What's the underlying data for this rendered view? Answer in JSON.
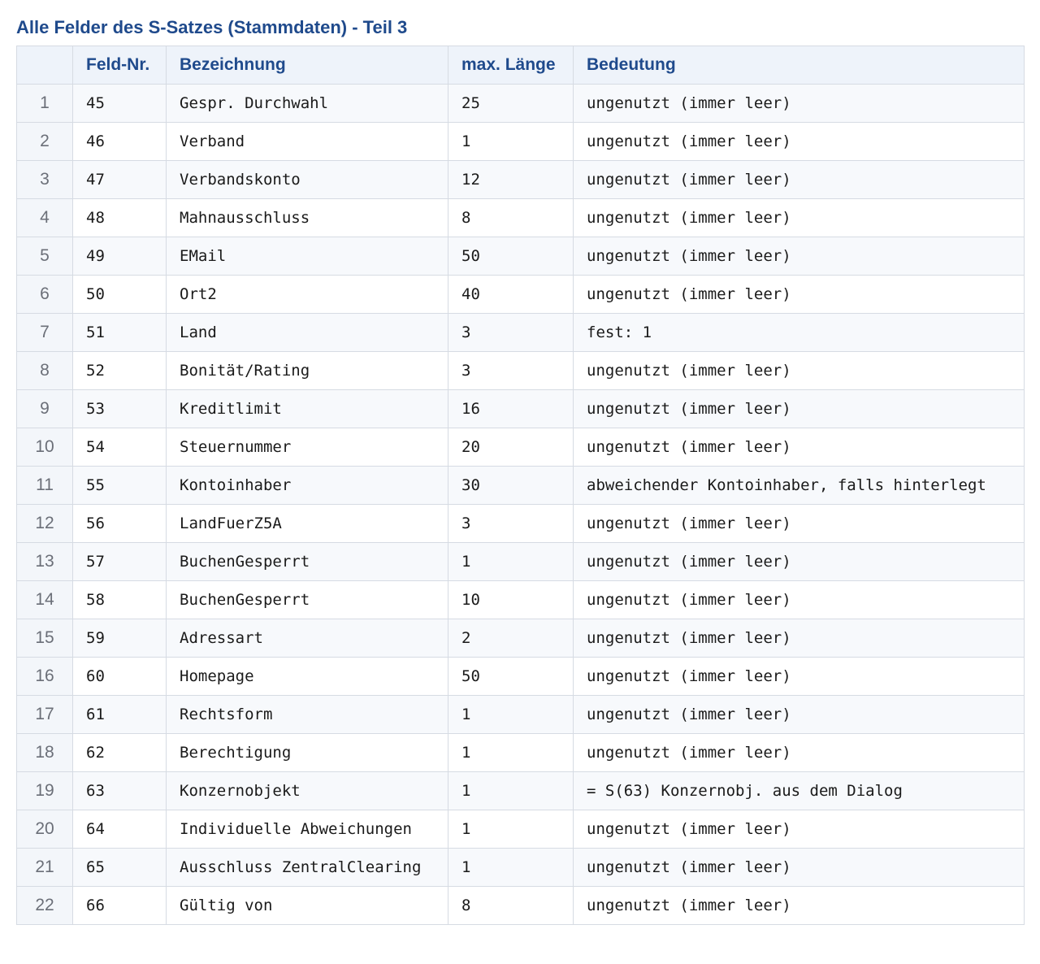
{
  "title": "Alle Felder des S-Satzes (Stammdaten) - Teil 3",
  "table": {
    "columns": [
      "",
      "Feld-Nr.",
      "Bezeichnung",
      "max. Länge",
      "Bedeutung"
    ],
    "rows": [
      {
        "index": "1",
        "feld_nr": "45",
        "bezeichnung": "Gespr. Durchwahl",
        "max_laenge": "25",
        "bedeutung": "ungenutzt (immer leer)"
      },
      {
        "index": "2",
        "feld_nr": "46",
        "bezeichnung": "Verband",
        "max_laenge": "1",
        "bedeutung": "ungenutzt (immer leer)"
      },
      {
        "index": "3",
        "feld_nr": "47",
        "bezeichnung": "Verbandskonto",
        "max_laenge": "12",
        "bedeutung": "ungenutzt (immer leer)"
      },
      {
        "index": "4",
        "feld_nr": "48",
        "bezeichnung": "Mahnausschluss",
        "max_laenge": "8",
        "bedeutung": "ungenutzt (immer leer)"
      },
      {
        "index": "5",
        "feld_nr": "49",
        "bezeichnung": "EMail",
        "max_laenge": "50",
        "bedeutung": "ungenutzt (immer leer)"
      },
      {
        "index": "6",
        "feld_nr": "50",
        "bezeichnung": "Ort2",
        "max_laenge": "40",
        "bedeutung": "ungenutzt (immer leer)"
      },
      {
        "index": "7",
        "feld_nr": "51",
        "bezeichnung": "Land",
        "max_laenge": "3",
        "bedeutung": "fest: 1"
      },
      {
        "index": "8",
        "feld_nr": "52",
        "bezeichnung": "Bonität/Rating",
        "max_laenge": "3",
        "bedeutung": "ungenutzt (immer leer)"
      },
      {
        "index": "9",
        "feld_nr": "53",
        "bezeichnung": "Kreditlimit",
        "max_laenge": "16",
        "bedeutung": "ungenutzt (immer leer)"
      },
      {
        "index": "10",
        "feld_nr": "54",
        "bezeichnung": "Steuernummer",
        "max_laenge": "20",
        "bedeutung": "ungenutzt (immer leer)"
      },
      {
        "index": "11",
        "feld_nr": "55",
        "bezeichnung": "Kontoinhaber",
        "max_laenge": "30",
        "bedeutung": "abweichender Kontoinhaber, falls hinterlegt"
      },
      {
        "index": "12",
        "feld_nr": "56",
        "bezeichnung": "LandFuerZ5A",
        "max_laenge": "3",
        "bedeutung": "ungenutzt (immer leer)"
      },
      {
        "index": "13",
        "feld_nr": "57",
        "bezeichnung": "BuchenGesperrt",
        "max_laenge": "1",
        "bedeutung": "ungenutzt (immer leer)"
      },
      {
        "index": "14",
        "feld_nr": "58",
        "bezeichnung": "BuchenGesperrt",
        "max_laenge": "10",
        "bedeutung": "ungenutzt (immer leer)"
      },
      {
        "index": "15",
        "feld_nr": "59",
        "bezeichnung": "Adressart",
        "max_laenge": "2",
        "bedeutung": "ungenutzt (immer leer)"
      },
      {
        "index": "16",
        "feld_nr": "60",
        "bezeichnung": "Homepage",
        "max_laenge": "50",
        "bedeutung": "ungenutzt (immer leer)"
      },
      {
        "index": "17",
        "feld_nr": "61",
        "bezeichnung": "Rechtsform",
        "max_laenge": "1",
        "bedeutung": "ungenutzt (immer leer)"
      },
      {
        "index": "18",
        "feld_nr": "62",
        "bezeichnung": "Berechtigung",
        "max_laenge": "1",
        "bedeutung": "ungenutzt (immer leer)"
      },
      {
        "index": "19",
        "feld_nr": "63",
        "bezeichnung": "Konzernobjekt",
        "max_laenge": "1",
        "bedeutung": "= S(63) Konzernobj. aus dem Dialog"
      },
      {
        "index": "20",
        "feld_nr": "64",
        "bezeichnung": "Individuelle Abweichungen",
        "max_laenge": "1",
        "bedeutung": "ungenutzt (immer leer)"
      },
      {
        "index": "21",
        "feld_nr": "65",
        "bezeichnung": "Ausschluss ZentralClearing",
        "max_laenge": "1",
        "bedeutung": "ungenutzt (immer leer)"
      },
      {
        "index": "22",
        "feld_nr": "66",
        "bezeichnung": "Gültig von",
        "max_laenge": "8",
        "bedeutung": "ungenutzt (immer leer)"
      }
    ]
  },
  "colors": {
    "title": "#1f4a8c",
    "header_background": "#eef3fa",
    "border": "#d6dbe3",
    "index_text": "#6b6f78"
  }
}
